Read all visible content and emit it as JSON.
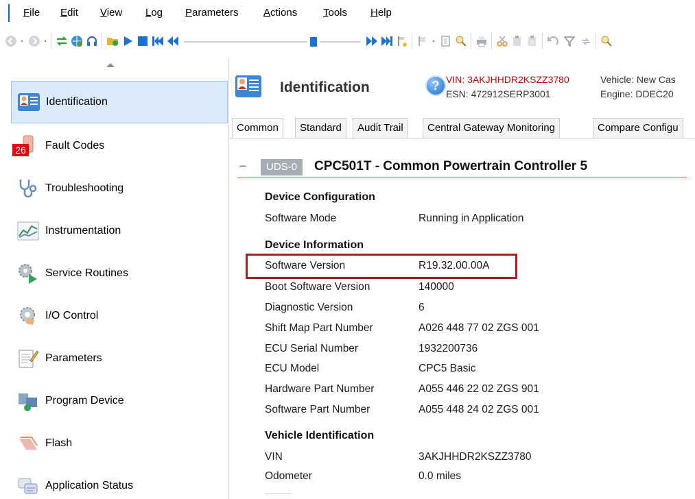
{
  "menu": [
    "File",
    "Edit",
    "View",
    "Log",
    "Parameters",
    "Actions",
    "Tools",
    "Help"
  ],
  "menu_underline": [
    "F",
    "E",
    "V",
    "L",
    "P",
    "A",
    "T",
    "H"
  ],
  "colors": {
    "accent_blue": "#1b72d1",
    "vin_red": "#d60000",
    "badge_red": "#e8000b",
    "highlight_border": "#a52222",
    "active_nav": "#dcebfb"
  },
  "toolbar": {
    "icons": [
      "back-icon",
      "forward-icon",
      "connect-icon",
      "globe-icon",
      "headset-icon",
      "folder-icon",
      "play-icon",
      "stop-icon",
      "skip-start-icon",
      "rewind-icon",
      "fast-forward-icon",
      "skip-end-icon",
      "marker-icon",
      "flag-icon",
      "copy-icon",
      "find-icon",
      "print-icon",
      "cut-icon",
      "paste-icon",
      "undo-icon",
      "filter-icon",
      "refresh-icon",
      "search-icon"
    ],
    "slider_position": 0.33
  },
  "sidebar": {
    "items": [
      {
        "label": "Identification",
        "icon": "id-card-icon",
        "active": true
      },
      {
        "label": "Fault Codes",
        "icon": "fault-codes-icon",
        "badge": "26"
      },
      {
        "label": "Troubleshooting",
        "icon": "stethoscope-icon"
      },
      {
        "label": "Instrumentation",
        "icon": "chart-icon"
      },
      {
        "label": "Service Routines",
        "icon": "gears-play-icon"
      },
      {
        "label": "I/O Control",
        "icon": "gear-hand-icon"
      },
      {
        "label": "Parameters",
        "icon": "notepad-pencil-icon"
      },
      {
        "label": "Program Device",
        "icon": "program-device-icon"
      },
      {
        "label": "Flash",
        "icon": "flash-icon"
      },
      {
        "label": "Application Status",
        "icon": "application-status-icon"
      }
    ]
  },
  "header": {
    "title": "Identification",
    "vin": "VIN: 3AKJHHDR2KSZZ3780",
    "esn": "ESN: 472912SERP3001",
    "vehicle": "Vehicle: New Cas",
    "engine": "Engine: DDEC20"
  },
  "tabs": [
    "Common",
    "Standard",
    "Audit Trail",
    "Central Gateway Monitoring",
    "Compare Configu"
  ],
  "device": {
    "tag": "UDS-0",
    "name": "CPC501T - Common Powertrain Controller 5"
  },
  "groups": {
    "config": "Device Configuration",
    "info": "Device Information",
    "vehicle": "Vehicle Identification"
  },
  "props": {
    "software_mode": {
      "label": "Software Mode",
      "value": "Running in Application"
    },
    "software_version": {
      "label": "Software Version",
      "value": "R19.32.00.00A"
    },
    "boot_version": {
      "label": "Boot Software Version",
      "value": "140000"
    },
    "diag_version": {
      "label": "Diagnostic Version",
      "value": "6"
    },
    "shift_map": {
      "label": "Shift Map Part Number",
      "value": "A026 448 77 02 ZGS 001"
    },
    "ecu_serial": {
      "label": "ECU Serial Number",
      "value": "1932200736"
    },
    "ecu_model": {
      "label": "ECU Model",
      "value": "CPC5 Basic"
    },
    "hw_part": {
      "label": "Hardware Part Number",
      "value": "A055 446 22 02 ZGS 901"
    },
    "sw_part": {
      "label": "Software Part Number",
      "value": "A055 448 24 02 ZGS 001"
    },
    "vin": {
      "label": "VIN",
      "value": "3AKJHHDR2KSZZ3780"
    },
    "odometer": {
      "label": "Odometer",
      "value": "0.0 miles"
    }
  }
}
